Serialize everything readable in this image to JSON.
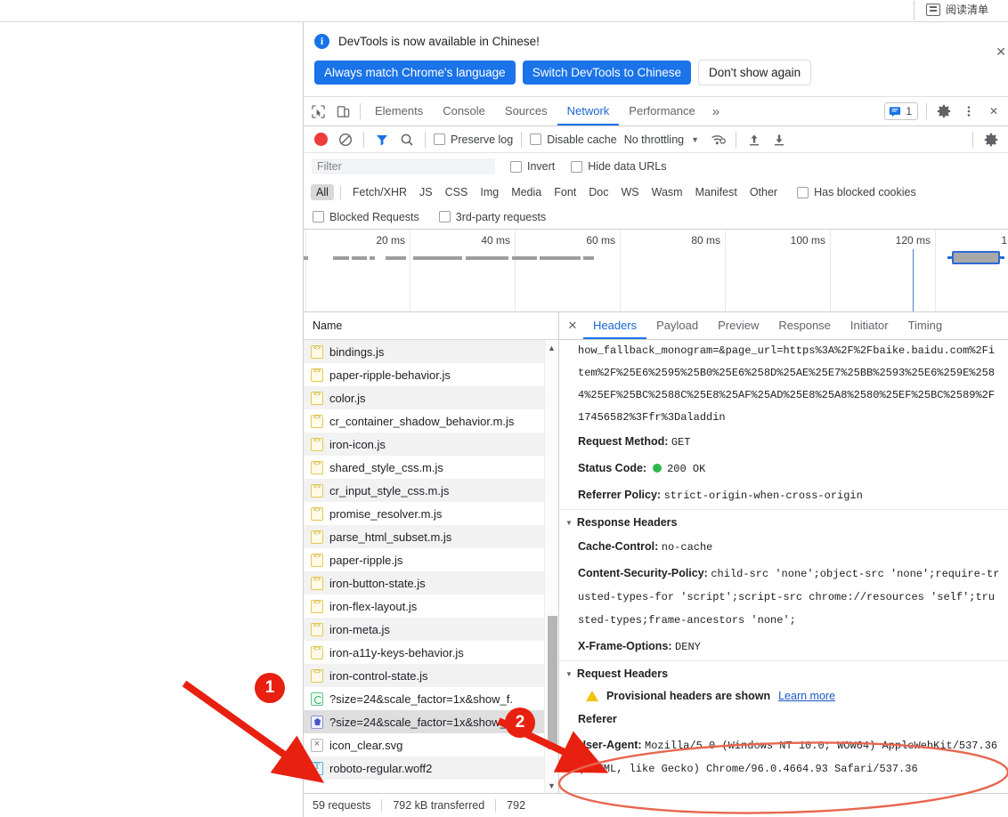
{
  "browser": {
    "reading_list_label": "阅读清单",
    "reading_list_icon": "reading-list-icon"
  },
  "infobar": {
    "message": "DevTools is now available in Chinese!",
    "info_icon": "info-icon",
    "buttons": [
      {
        "label": "Always match Chrome's language",
        "style": "primary"
      },
      {
        "label": "Switch DevTools to Chinese",
        "style": "primary"
      },
      {
        "label": "Don't show again",
        "style": "plain"
      }
    ],
    "close_icon": "close-icon"
  },
  "tabbar": {
    "inspect_icon": "inspect-cursor-icon",
    "device_icon": "device-toolbar-icon",
    "tabs": [
      {
        "label": "Elements",
        "active": false
      },
      {
        "label": "Console",
        "active": false
      },
      {
        "label": "Sources",
        "active": false
      },
      {
        "label": "Network",
        "active": true
      },
      {
        "label": "Performance",
        "active": false
      }
    ],
    "more_tabs_icon": "chevron-double-right-icon",
    "message_icon": "message-icon",
    "message_count": "1",
    "settings_icon": "gear-icon",
    "menu_icon": "kebab-menu-icon",
    "close_icon": "close-icon"
  },
  "network_toolbar": {
    "record_icon": "record-stop-icon",
    "clear_icon": "clear-icon",
    "filter_icon": "funnel-filter-icon",
    "search_icon": "search-icon",
    "preserve_log_label": "Preserve log",
    "preserve_log_checked": false,
    "disable_cache_label": "Disable cache",
    "disable_cache_checked": false,
    "throttling_value": "No throttling",
    "throttling_caret_icon": "chevron-down-icon",
    "wifi_icon": "wifi-settings-icon",
    "import_icon": "upload-arrow-icon",
    "export_icon": "download-arrow-icon",
    "settings_icon": "gear-icon"
  },
  "filter_row": {
    "placeholder": "Filter",
    "value": "",
    "invert_label": "Invert",
    "invert_checked": false,
    "hide_data_urls_label": "Hide data URLs",
    "hide_data_urls_checked": false
  },
  "type_filters": {
    "chips": [
      "All",
      "Fetch/XHR",
      "JS",
      "CSS",
      "Img",
      "Media",
      "Font",
      "Doc",
      "WS",
      "Wasm",
      "Manifest",
      "Other"
    ],
    "selected": "All",
    "has_blocked_cookies_label": "Has blocked cookies",
    "has_blocked_cookies_checked": false,
    "blocked_requests_label": "Blocked Requests",
    "blocked_requests_checked": false,
    "third_party_label": "3rd-party requests",
    "third_party_checked": false
  },
  "overview": {
    "ticks": [
      "20 ms",
      "40 ms",
      "60 ms",
      "80 ms",
      "100 ms",
      "120 ms",
      "1"
    ],
    "marker_time_ms": 120,
    "selection_label": "waterfall-selection"
  },
  "request_list": {
    "column_header": "Name",
    "rows": [
      {
        "name": "bindings.js",
        "icon": "js-file-icon",
        "selected": false
      },
      {
        "name": "paper-ripple-behavior.js",
        "icon": "js-file-icon",
        "selected": false
      },
      {
        "name": "color.js",
        "icon": "js-file-icon",
        "selected": false
      },
      {
        "name": "cr_container_shadow_behavior.m.js",
        "icon": "js-file-icon",
        "selected": false
      },
      {
        "name": "iron-icon.js",
        "icon": "js-file-icon",
        "selected": false
      },
      {
        "name": "shared_style_css.m.js",
        "icon": "js-file-icon",
        "selected": false
      },
      {
        "name": "cr_input_style_css.m.js",
        "icon": "js-file-icon",
        "selected": false
      },
      {
        "name": "promise_resolver.m.js",
        "icon": "js-file-icon",
        "selected": false
      },
      {
        "name": "parse_html_subset.m.js",
        "icon": "js-file-icon",
        "selected": false
      },
      {
        "name": "paper-ripple.js",
        "icon": "js-file-icon",
        "selected": false
      },
      {
        "name": "iron-button-state.js",
        "icon": "js-file-icon",
        "selected": false
      },
      {
        "name": "iron-flex-layout.js",
        "icon": "js-file-icon",
        "selected": false
      },
      {
        "name": "iron-meta.js",
        "icon": "js-file-icon",
        "selected": false
      },
      {
        "name": "iron-a11y-keys-behavior.js",
        "icon": "js-file-icon",
        "selected": false
      },
      {
        "name": "iron-control-state.js",
        "icon": "js-file-icon",
        "selected": false
      },
      {
        "name": "?size=24&scale_factor=1x&show_f.",
        "icon": "image-green-icon",
        "selected": false
      },
      {
        "name": "?size=24&scale_factor=1x&show_f.",
        "icon": "image-blue-icon",
        "selected": true
      },
      {
        "name": "icon_clear.svg",
        "icon": "svg-file-icon",
        "selected": false
      },
      {
        "name": "roboto-regular.woff2",
        "icon": "font-file-icon",
        "selected": false
      }
    ],
    "scroll_up_icon": "scroll-up-arrow-icon",
    "scroll_down_icon": "scroll-down-arrow-icon"
  },
  "details": {
    "close_icon": "close-icon",
    "tabs": [
      {
        "label": "Headers",
        "active": true
      },
      {
        "label": "Payload",
        "active": false
      },
      {
        "label": "Preview",
        "active": false
      },
      {
        "label": "Response",
        "active": false
      },
      {
        "label": "Initiator",
        "active": false
      },
      {
        "label": "Timing",
        "active": false
      }
    ],
    "general": {
      "request_url_tail": "how_fallback_monogram=&page_url=https%3A%2F%2Fbaike.baidu.com%2Fitem%2F%25E6%2595%25B0%25E6%258D%25AE%25E7%25BB%2593%25E6%259E%2584%25EF%25BC%2588C%25E8%25AF%25AD%25E8%25A8%2580%25EF%25BC%2589%2F17456582%3Ffr%3Daladdin",
      "request_method_key": "Request Method:",
      "request_method_value": "GET",
      "status_code_key": "Status Code:",
      "status_code_value": "200 OK",
      "status_color": "#2db84d",
      "referrer_policy_key": "Referrer Policy:",
      "referrer_policy_value": "strict-origin-when-cross-origin"
    },
    "response_headers": {
      "title": "Response Headers",
      "items": [
        {
          "key": "Cache-Control:",
          "value": "no-cache"
        },
        {
          "key": "Content-Security-Policy:",
          "value": "child-src 'none';object-src 'none';require-trusted-types-for 'script';script-src chrome://resources 'self';trusted-types;frame-ancestors 'none';"
        },
        {
          "key": "X-Frame-Options:",
          "value": "DENY"
        }
      ]
    },
    "request_headers": {
      "title": "Request Headers",
      "warning_text": "Provisional headers are shown",
      "warning_icon": "warning-triangle-icon",
      "learn_more_label": "Learn more",
      "referer_key": "Referer",
      "user_agent_key": "User-Agent:",
      "user_agent_value": "Mozilla/5.0 (Windows NT 10.0; WOW64) AppleWebKit/537.36 (KHTML, like Gecko) Chrome/96.0.4664.93 Safari/537.36"
    }
  },
  "statusbar": {
    "requests": "59 requests",
    "transferred": "792 kB transferred",
    "resources": "792"
  },
  "annotations": {
    "accent_color": "#e8200f",
    "highlight_color": "#e8664f",
    "markers": [
      {
        "number": "1",
        "points_to": "request-row-selected"
      },
      {
        "number": "2",
        "points_to": "user-agent-header"
      }
    ]
  }
}
